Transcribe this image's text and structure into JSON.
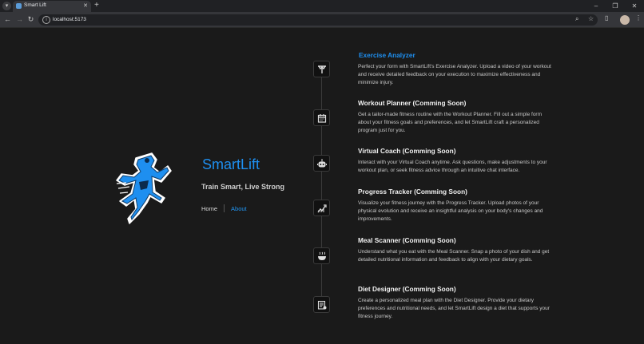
{
  "browser": {
    "tab_title": "Smart Lift",
    "url": "localhost:5173"
  },
  "hero": {
    "title": "SmartLift",
    "tagline": "Train Smart, Live Strong",
    "nav": {
      "home": "Home",
      "about": "About"
    }
  },
  "features": [
    {
      "title": "Exercise Analyzer",
      "icon": "dumbbell-icon",
      "active": true,
      "description": "Perfect your form with SmartLift's Exercise Analyzer. Upload a video of your workout and receive detailed feedback on your execution to maximize effectiveness and minimize injury."
    },
    {
      "title": "Workout Planner (Comming Soon)",
      "icon": "calendar-icon",
      "description": "Get a tailor-made fitness routine with the Workout Planner. Fill out a simple form about your fitness goals and preferences, and let SmartLift craft a personalized program just for you."
    },
    {
      "title": "Virtual Coach (Comming Soon)",
      "icon": "robot-icon",
      "description": "Interact with your Virtual Coach anytime. Ask questions, make adjustments to your workout plan, or seek fitness advice through an intuitive chat interface."
    },
    {
      "title": "Progress Tracker (Comming Soon)",
      "icon": "progress-icon",
      "description": "Visualize your fitness journey with the Progress Tracker. Upload photos of your physical evolution and receive an insightful analysis on your body's changes and improvements."
    },
    {
      "title": "Meal Scanner (Comming Soon)",
      "icon": "meal-icon",
      "description": "Understand what you eat with the Meal Scanner. Snap a photo of your dish and get detailed nutritional information and feedback to align with your dietary goals."
    },
    {
      "title": "Diet Designer (Comming Soon)",
      "icon": "diet-list-icon",
      "description": "Create a personalized meal plan with the Diet Designer. Provide your dietary preferences and nutritional needs, and let SmartLift design a diet that supports your fitness journey."
    }
  ],
  "colors": {
    "accent": "#1e8ff0",
    "background": "#1a1a1a"
  }
}
